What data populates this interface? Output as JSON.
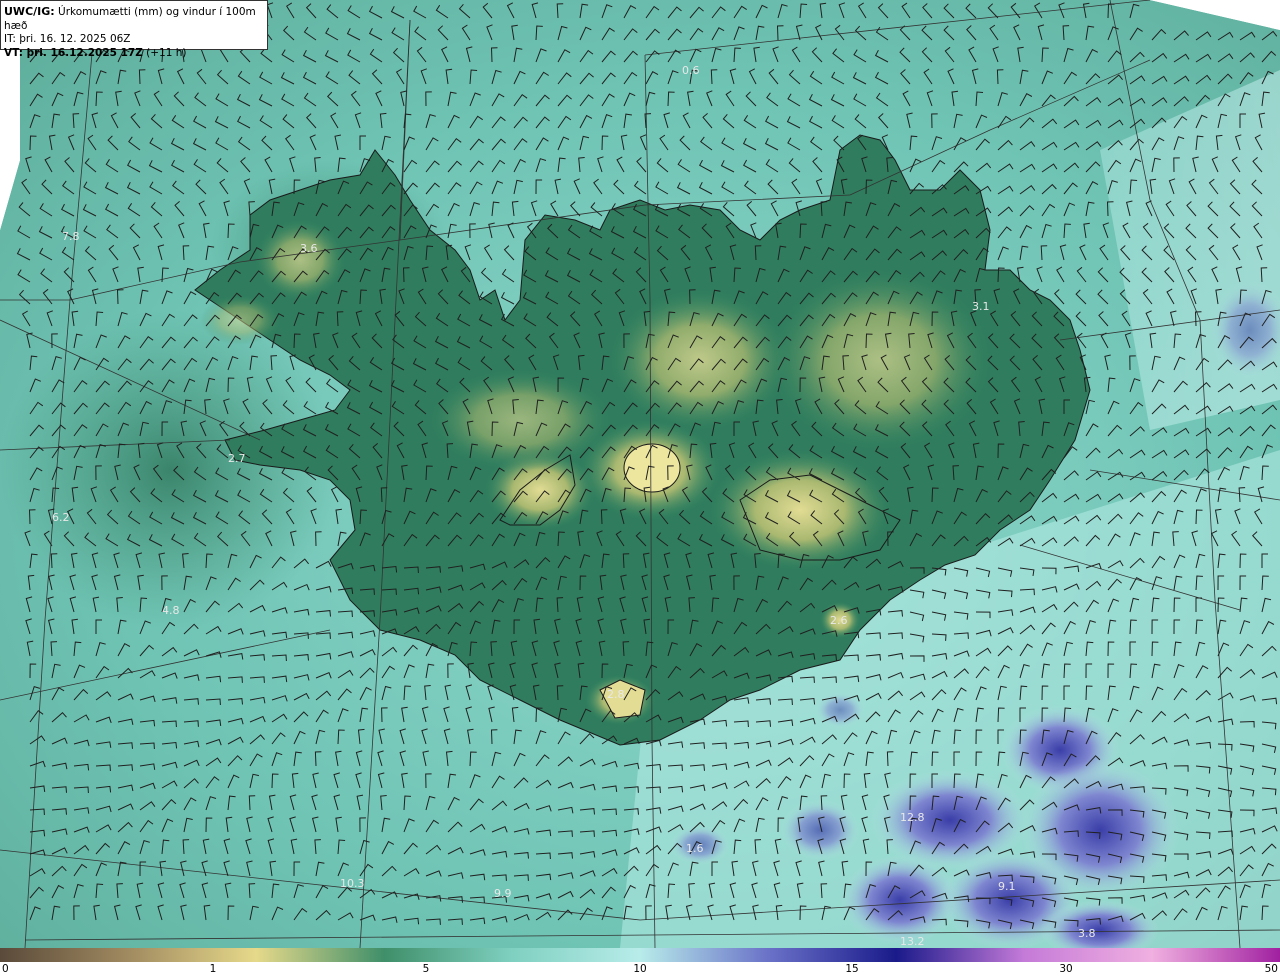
{
  "header": {
    "model": "UWC/IG:",
    "title": " Úrkomumætti (mm) og vindur í 100m hæð",
    "init_label": "IT: þri. 16. 12. 2025 06Z",
    "valid_prefix": "VT: þri. 16.12.2025 17Z",
    "valid_suffix": " (+11 h)"
  },
  "value_labels": [
    "3.6",
    "7.8",
    "6.2",
    "4.8",
    "2.7",
    "0.6",
    "3.1",
    "2.6",
    "2.8",
    "10.3",
    "9.9",
    "12.8",
    "13.2",
    "3.8",
    "9.1",
    "1.6"
  ],
  "colorbar": {
    "ticks": [
      "0",
      "1",
      "5",
      "10",
      "15",
      "30",
      "50"
    ],
    "colors": [
      "#5a4a3a",
      "#a08a60",
      "#e6d98a",
      "#3f8f6a",
      "#7fd0c0",
      "#b8ecea",
      "#6a72c8",
      "#1a1a8a",
      "#c47ad8",
      "#f0b0e0",
      "#a020a0"
    ]
  },
  "colors": {
    "sea": "#7ccfc0",
    "land_low": "#2e7a5e",
    "land_high": "#c8c878",
    "heavy_precip": "#5a5ec0"
  }
}
